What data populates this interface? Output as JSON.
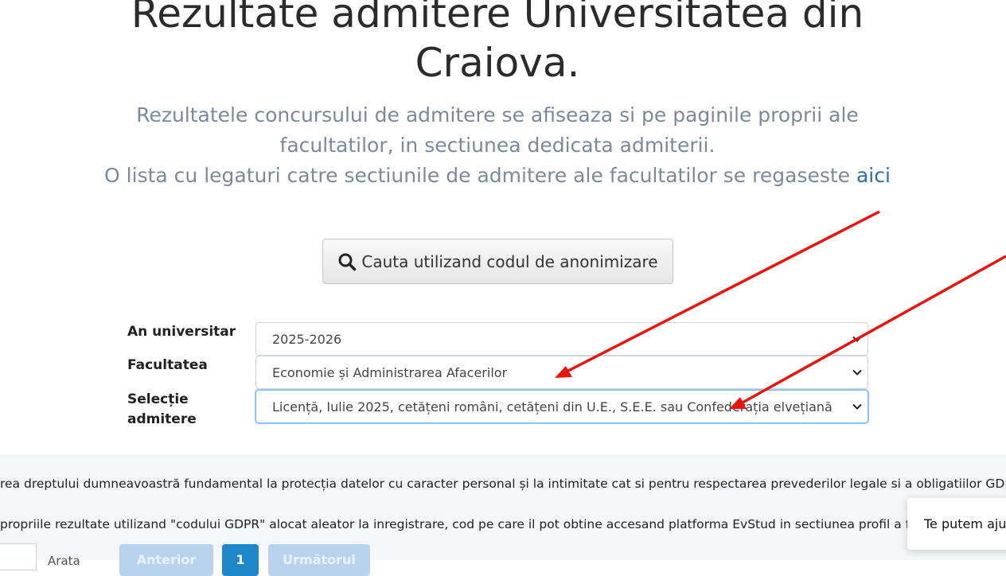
{
  "header": {
    "title_line1": "Rezultate admitere Universitatea din",
    "title_line2": "Craiova."
  },
  "intro": {
    "line1": "Rezultatele concursului de admitere se afiseaza si pe paginile proprii ale",
    "line2": "facultatilor, in sectiunea dedicata admiterii.",
    "line3_prefix": "O lista cu legaturi catre sectiunile de admitere ale facultatilor se regaseste ",
    "link_text": "aici"
  },
  "search_button": {
    "label": "Cauta utilizand codul de anonimizare",
    "icon": "search-icon"
  },
  "form": {
    "year_label": "An universitar",
    "year_value": "2025-2026",
    "faculty_label": "Facultatea",
    "faculty_value": "Economie și Administrarea Afacerilor",
    "selection_label_line1": "Selecție",
    "selection_label_line2": "admitere",
    "selection_value": "Licență, Iulie 2025, cetățeni români, cetățeni din U.E., S.E.E. sau Confederația elvețiană"
  },
  "gdpr": {
    "line1": "rea dreptului dumneavoastră fundamental la protecția datelor cu caracter personal și la intimitate cat si pentru respectarea prevederilor legale si a obligatiilor GDPR",
    "line2": "propriile rezultate utilizand \"codului GDPR\" alocat aleator la inregistrare, cod pe care il pot obtine accesand platforma EvStud in sectiunea profil a f"
  },
  "help_toast": {
    "text": "Te putem ajuta"
  },
  "pagination": {
    "size_label": "Arata ",
    "prev_label": "Anterior",
    "current_page": "1",
    "next_label": "Următorul"
  },
  "annotation_color": "#e8140e"
}
